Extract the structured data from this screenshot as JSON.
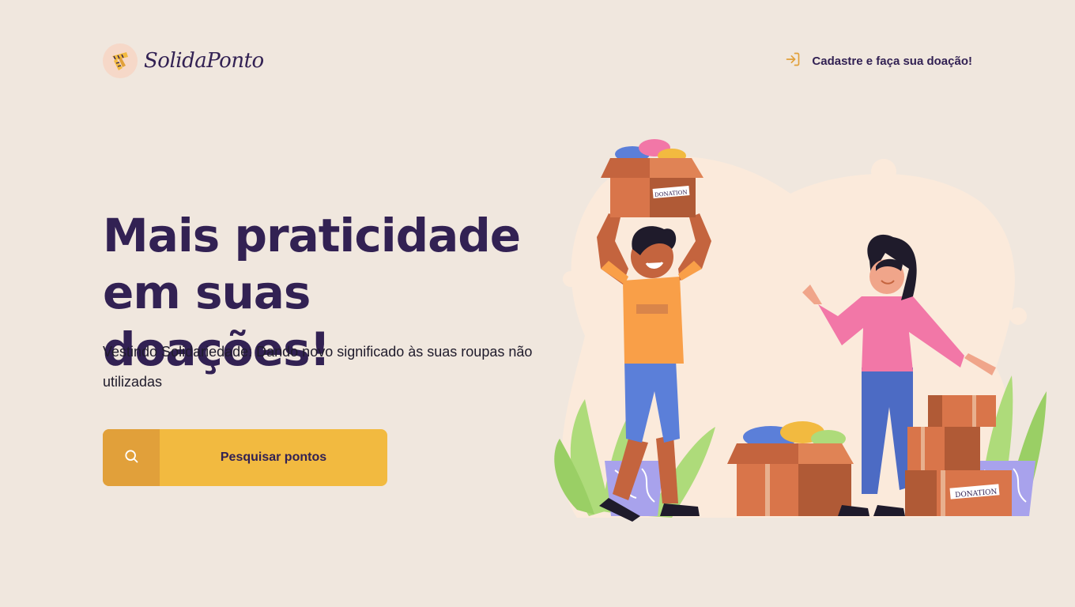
{
  "header": {
    "logo_text": "SolidaPonto",
    "register_label": "Cadastre e faça sua doação!"
  },
  "hero": {
    "title_line1": "Mais praticidade",
    "title_line2": "em suas doações!",
    "subtitle": "Vestindo Solidariedade: Dando novo significado às suas roupas não utilizadas",
    "search_button_label": "Pesquisar pontos"
  },
  "illustration": {
    "box_label_top": "DONATION",
    "box_label_bottom": "DONATION"
  },
  "colors": {
    "background": "#F0E7DE",
    "primary_text": "#322153",
    "accent": "#F2BA40",
    "accent_dark": "#E1A03A"
  },
  "icons": {
    "logo": "scarf-icon",
    "register": "sign-in-icon",
    "search": "search-icon"
  }
}
